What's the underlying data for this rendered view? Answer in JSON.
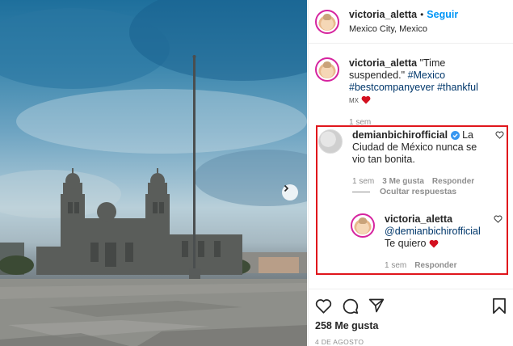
{
  "post": {
    "photo_alt": "Mexico City cathedral and flagpole under cloudy sky"
  },
  "header": {
    "username": "victoria_aletta",
    "separator": "•",
    "follow_label": "Seguir",
    "location": "Mexico City, Mexico"
  },
  "caption": {
    "username": "victoria_aletta",
    "text": "\"Time suspended.\"",
    "hashtags": [
      "#Mexico",
      "#bestcompanyever",
      "#thankful"
    ],
    "flag_text": "MX",
    "time": "1 sem"
  },
  "comment": {
    "username": "demianbichirofficial",
    "text": "La Ciudad de México nunca se vio tan bonita.",
    "time": "1 sem",
    "likes": "3 Me gusta",
    "reply_label": "Responder",
    "hide_replies_label": "Ocultar respuestas"
  },
  "reply": {
    "username": "victoria_aletta",
    "mention": "@demianbichirofficial",
    "text": "Te quiero",
    "time": "1 sem",
    "reply_label": "Responder"
  },
  "footer": {
    "likes": "258 Me gusta",
    "date": "4 DE AGOSTO"
  },
  "colors": {
    "accent": "#0095f6",
    "heart": "#ed4956",
    "highlight": "#e0161c",
    "link": "#00376b"
  }
}
